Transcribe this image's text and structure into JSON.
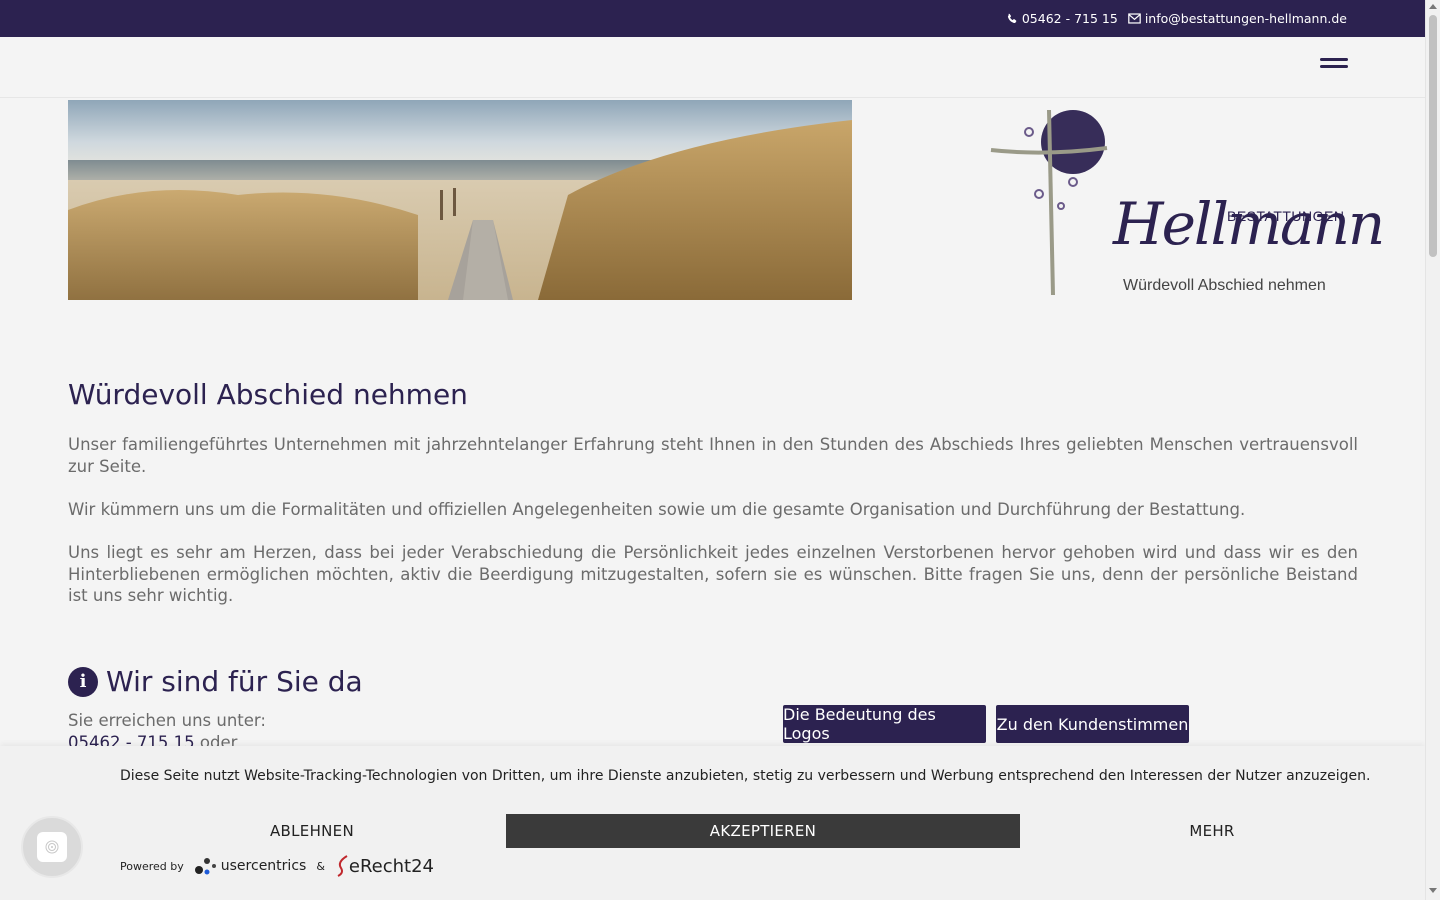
{
  "topbar": {
    "phone": "05462 - 715 15",
    "email": "info@bestattungen-hellmann.de"
  },
  "logo": {
    "wordmark": "Hellmann",
    "tagline_top": "BESTATTUNGEN",
    "slogan": "Würdevoll Abschied nehmen"
  },
  "content": {
    "title": "Würdevoll Abschied nehmen",
    "paragraphs": [
      "Unser familiengeführtes Unternehmen mit jahrzehntelanger Erfahrung steht Ihnen in den Stunden des Abschieds Ihres geliebten Menschen vertrauensvoll zur Seite.",
      "Wir kümmern uns um die Formalitäten und offiziellen Angelegenheiten sowie um die gesamte Organisation und Durchführung der Bestattung.",
      "Uns liegt es sehr am Herzen, dass bei jeder Verabschiedung die Persönlichkeit jedes einzelnen Verstorbenen hervor gehoben wird und dass wir es den Hinterbliebenen ermöglichen möchten, aktiv die Beerdigung mitzugestalten, sofern sie es wünschen. Bitte fragen Sie uns, denn der persönliche Beistand ist uns sehr wichtig."
    ],
    "section_title": "Wir sind für Sie da",
    "reach_label": "Sie erreichen uns unter:",
    "reach_phone": "05462 - 715 15",
    "reach_or": "oder",
    "button_logo": "Die Bedeutung des Logos",
    "button_reviews": "Zu den Kundenstimmen"
  },
  "cookie": {
    "text": "Diese Seite nutzt Website-Tracking-Technologien von Dritten, um ihre Dienste anzubieten, stetig zu verbessern und Werbung entsprechend den Interessen der Nutzer anzuzeigen.",
    "decline": "ABLEHNEN",
    "accept": "AKZEPTIEREN",
    "more": "MEHR",
    "powered_by": "Powered by",
    "brand1": "usercentrics",
    "amp": "&",
    "brand2": "eRecht24"
  },
  "colors": {
    "brand": "#2c2250",
    "accent_gray": "#9a9a88",
    "accept_button": "#3a3a3a"
  }
}
